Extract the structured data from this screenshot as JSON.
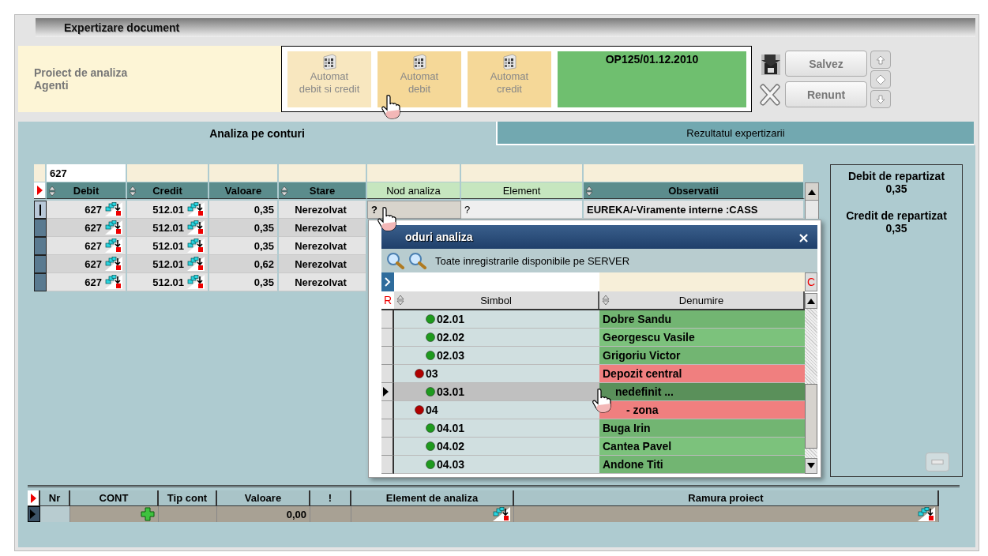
{
  "window": {
    "title": "Expertizare document"
  },
  "project": {
    "label": "Proiect de analiza",
    "name": "Agenti"
  },
  "auto_buttons": [
    {
      "lines": [
        "Automat",
        "debit si credit"
      ],
      "highlighted": false
    },
    {
      "lines": [
        "Automat",
        "debit"
      ],
      "highlighted": true
    },
    {
      "lines": [
        "Automat",
        "credit"
      ],
      "highlighted": true
    }
  ],
  "document": {
    "label": "OP125/01.12.2010"
  },
  "actions": [
    {
      "label": "Salvez",
      "kind": "save"
    },
    {
      "label": "Renunt",
      "kind": "cancel"
    }
  ],
  "tabs": [
    {
      "label": "Analiza pe conturi",
      "selected": true
    },
    {
      "label": "Rezultatul expertizarii",
      "selected": false
    }
  ],
  "grid": {
    "filter": "627",
    "columns": [
      {
        "label": "Debit",
        "sortable": true,
        "kind": "account"
      },
      {
        "label": "Credit",
        "sortable": true,
        "kind": "account"
      },
      {
        "label": "Valoare",
        "sortable": false,
        "kind": "number"
      },
      {
        "label": "Stare",
        "sortable": true,
        "kind": "status"
      },
      {
        "label": "Nod analiza",
        "sortable": false,
        "kind": "node"
      },
      {
        "label": "Element",
        "sortable": false,
        "kind": "element"
      },
      {
        "label": "Observatii",
        "sortable": true,
        "kind": "notes"
      }
    ],
    "rows": [
      {
        "cells": [
          "627",
          "512.01",
          "0,35",
          "Nerezolvat",
          "?",
          "?",
          "EUREKA/-Viramente interne :CASS"
        ],
        "selected": true
      },
      {
        "cells": [
          "627",
          "512.01",
          "0,35",
          "Nerezolvat"
        ],
        "selected": false
      },
      {
        "cells": [
          "627",
          "512.01",
          "0,35",
          "Nerezolvat"
        ],
        "selected": false
      },
      {
        "cells": [
          "627",
          "512.01",
          "0,62",
          "Nerezolvat"
        ],
        "selected": false
      },
      {
        "cells": [
          "627",
          "512.01",
          "0,35",
          "Nerezolvat"
        ],
        "selected": false
      }
    ]
  },
  "popup": {
    "title": "oduri analiza",
    "close": "×",
    "filter_text": "Toate inregistrarile disponibile pe SERVER",
    "marker_left": "R",
    "marker_right": "C",
    "columns": [
      "Simbol",
      "Denumire"
    ],
    "rows": [
      {
        "children": [
          {
            "symbol": "02.01",
            "name": "Dobre Sandu",
            "color": "#1e9a1e",
            "selected": false
          },
          {
            "symbol": "02.02",
            "name": "Georgescu Vasile",
            "color": "#1e9a1e",
            "selected": false
          },
          {
            "symbol": "02.03",
            "name": "Grigoriu Victor",
            "color": "#1e9a1e",
            "selected": false
          }
        ]
      },
      {
        "symbol": "03",
        "name": "Depozit central",
        "color": "#b00000",
        "selected": false,
        "children": [
          {
            "symbol": "03.01",
            "name": "nedefinit ...",
            "color": "#1e9a1e",
            "selected": true
          }
        ]
      },
      {
        "symbol": "04",
        "name": "- zona",
        "color": "#b00000",
        "selected": false,
        "children": [
          {
            "symbol": "04.01",
            "name": "Buga Irin",
            "color": "#1e9a1e",
            "selected": false
          },
          {
            "symbol": "04.02",
            "name": "Cantea Pavel",
            "color": "#1e9a1e",
            "selected": false
          },
          {
            "symbol": "04.03",
            "name": "Andone Titi",
            "color": "#1e9a1e",
            "selected": false
          }
        ]
      }
    ]
  },
  "summary": [
    {
      "label": "Debit de repartizat",
      "value": "0,35"
    },
    {
      "label": "Credit de repartizat",
      "value": "0,35"
    }
  ],
  "bottom_grid": {
    "columns": [
      "Nr",
      "CONT",
      "Tip cont",
      "Valoare",
      "!",
      "Element de analiza",
      "Ramura proiect"
    ],
    "row": {
      "valoare": "0,00"
    }
  }
}
